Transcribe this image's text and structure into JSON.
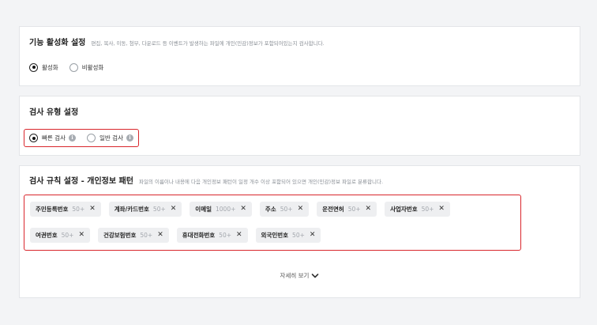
{
  "feature_section": {
    "title": "기능 활성화 설정",
    "description": "편집, 복사, 이동, 첨부, 다운로드 등 이벤트가 발생하는 파일에 개인(민감)정보가 포함되어있는지 검사합니다.",
    "options": [
      {
        "label": "활성화",
        "checked": true
      },
      {
        "label": "비활성화",
        "checked": false
      }
    ]
  },
  "scan_type_section": {
    "title": "검사 유형 설정",
    "options": [
      {
        "label": "빠른 검사",
        "checked": true,
        "icon": "info-icon"
      },
      {
        "label": "일반 검사",
        "checked": false,
        "icon": "info-icon"
      }
    ]
  },
  "rules_section": {
    "title": "검사 규칙 설정 - 개인정보 패턴",
    "description": "파일의 이름이나 내용에 다음 개인정보 패턴이 일정 개수 이상 포함되어 있으면 개인(민감)정보 파일로 분류합니다.",
    "row1": [
      {
        "name": "주민등록번호",
        "count": "50+"
      },
      {
        "name": "계좌/카드번호",
        "count": "50+"
      },
      {
        "name": "이메일",
        "count": "1000+"
      },
      {
        "name": "주소",
        "count": "50+"
      },
      {
        "name": "운전면허",
        "count": "50+"
      },
      {
        "name": "사업자번호",
        "count": "50+"
      }
    ],
    "row2": [
      {
        "name": "여권번호",
        "count": "50+"
      },
      {
        "name": "건강보험번호",
        "count": "50+"
      },
      {
        "name": "휴대전화번호",
        "count": "50+"
      },
      {
        "name": "외국인번호",
        "count": "50+"
      }
    ],
    "close_glyph": "✕",
    "more_label": "자세히 보기"
  }
}
